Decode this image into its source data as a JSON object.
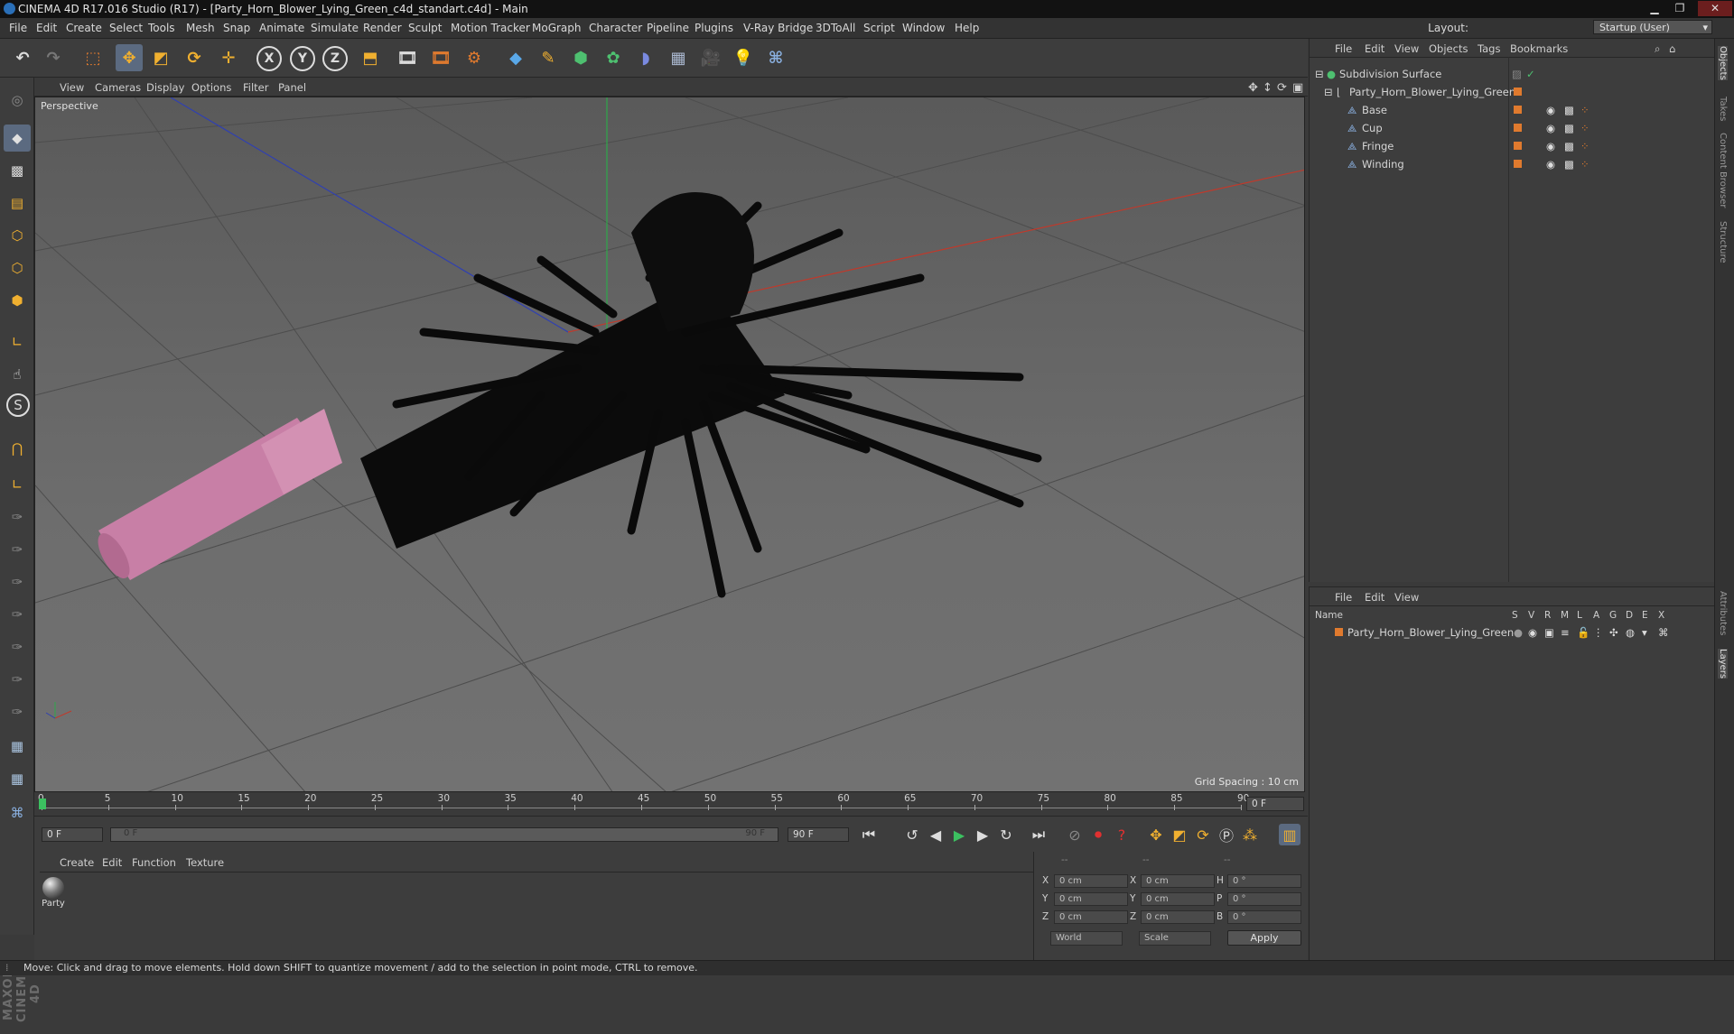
{
  "window": {
    "title": "CINEMA 4D R17.016 Studio (R17) - [Party_Horn_Blower_Lying_Green_c4d_standart.c4d] - Main"
  },
  "menu": [
    "File",
    "Edit",
    "Create",
    "Select",
    "Tools",
    "Mesh",
    "Snap",
    "Animate",
    "Simulate",
    "Render",
    "Sculpt",
    "Motion Tracker",
    "MoGraph",
    "Character",
    "Pipeline",
    "Plugins",
    "V-Ray Bridge",
    "3DToAll",
    "Script",
    "Window",
    "Help"
  ],
  "layout": {
    "label": "Layout:",
    "value": "Startup (User)"
  },
  "viewport": {
    "menu": [
      "View",
      "Cameras",
      "Display",
      "Options",
      "Filter",
      "Panel"
    ],
    "label": "Perspective",
    "grid_spacing": "Grid Spacing : 10 cm"
  },
  "timeline": {
    "ticks": [
      "0",
      "5",
      "10",
      "15",
      "20",
      "25",
      "30",
      "35",
      "40",
      "45",
      "50",
      "55",
      "60",
      "65",
      "70",
      "75",
      "80",
      "85",
      "90"
    ],
    "current_frame": "0 F",
    "start_field": "0 F",
    "range_start": "0 F",
    "range_end": "90 F",
    "end_field": "90 F"
  },
  "material_manager": {
    "menu": [
      "Create",
      "Edit",
      "Function",
      "Texture"
    ],
    "materials": [
      {
        "name": "Party"
      }
    ]
  },
  "coordinates": {
    "header": [
      "--",
      "--",
      "--"
    ],
    "rows": [
      {
        "a_label": "X",
        "a_val": "0 cm",
        "b_label": "X",
        "b_val": "0 cm",
        "c_label": "H",
        "c_val": "0 °"
      },
      {
        "a_label": "Y",
        "a_val": "0 cm",
        "b_label": "Y",
        "b_val": "0 cm",
        "c_label": "P",
        "c_val": "0 °"
      },
      {
        "a_label": "Z",
        "a_val": "0 cm",
        "b_label": "Z",
        "b_val": "0 cm",
        "c_label": "B",
        "c_val": "0 °"
      }
    ],
    "space": "World",
    "mode": "Scale",
    "apply": "Apply"
  },
  "object_manager": {
    "menu": [
      "File",
      "Edit",
      "View",
      "Objects",
      "Tags",
      "Bookmarks"
    ],
    "objects": [
      {
        "name": "Subdivision Surface",
        "level": 0
      },
      {
        "name": "Party_Horn_Blower_Lying_Green",
        "level": 1
      },
      {
        "name": "Base",
        "level": 2
      },
      {
        "name": "Cup",
        "level": 2
      },
      {
        "name": "Fringe",
        "level": 2
      },
      {
        "name": "Winding",
        "level": 2
      }
    ]
  },
  "layer_manager": {
    "menu": [
      "File",
      "Edit",
      "View"
    ],
    "columns": [
      "Name",
      "S",
      "V",
      "R",
      "M",
      "L",
      "A",
      "G",
      "D",
      "E",
      "X"
    ],
    "layers": [
      {
        "name": "Party_Horn_Blower_Lying_Green"
      }
    ]
  },
  "side_tabs": [
    "Objects",
    "Takes",
    "Content Browser",
    "Structure",
    "Attributes",
    "Layers"
  ],
  "status": "Move: Click and drag to move elements. Hold down SHIFT to quantize movement / add to the selection in point mode, CTRL to remove.",
  "brand": "MAXON CINEMA 4D",
  "colors": {
    "accent_orange": "#e07a2e",
    "horn_pink": "#c87fa6",
    "axis_x": "#c0392b",
    "axis_y": "#2ea84a",
    "axis_z": "#3040b0"
  }
}
